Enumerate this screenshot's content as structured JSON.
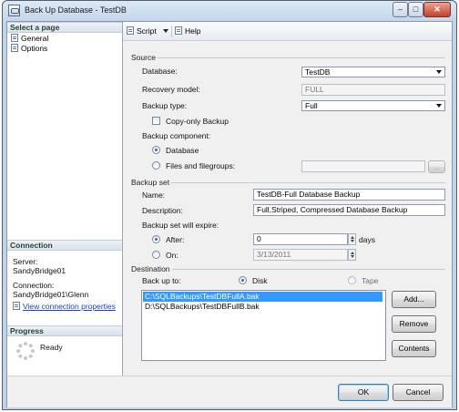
{
  "window": {
    "title": "Back Up Database - TestDB",
    "minimize": "–",
    "maximize": "□",
    "close": "✕"
  },
  "left_pane": {
    "select_page_header": "Select a page",
    "pages": [
      {
        "label": "General",
        "icon": "page-icon"
      },
      {
        "label": "Options",
        "icon": "page-icon"
      }
    ],
    "connection_header": "Connection",
    "server_label": "Server:",
    "server_value": "SandyBridge01",
    "connection_label": "Connection:",
    "connection_value": "SandyBridge01\\Glenn",
    "view_connection_link": "View connection properties",
    "progress_header": "Progress",
    "progress_status": "Ready"
  },
  "toolbar": {
    "script_label": "Script",
    "help_label": "Help"
  },
  "source": {
    "section_label": "Source",
    "database_label": "Database:",
    "database_value": "TestDB",
    "recovery_model_label": "Recovery model:",
    "recovery_model_value": "FULL",
    "backup_type_label": "Backup type:",
    "backup_type_value": "Full",
    "copy_only_label": "Copy-only Backup",
    "backup_component_label": "Backup component:",
    "database_radio_label": "Database",
    "files_radio_label": "Files and filegroups:",
    "browse_label": "..."
  },
  "backup_set": {
    "section_label": "Backup set",
    "name_label": "Name:",
    "name_value": "TestDB-Full Database Backup",
    "description_label": "Description:",
    "description_value": "Full,Striped, Compressed Database Backup",
    "expire_label": "Backup set will expire:",
    "after_label": "After:",
    "after_value": "0",
    "days_label": "days",
    "on_label": "On:",
    "on_value": "3/13/2011"
  },
  "destination": {
    "section_label": "Destination",
    "back_up_to_label": "Back up to:",
    "disk_label": "Disk",
    "tape_label": "Tape",
    "files": [
      "C:\\SQLBackups\\TestDBFullA.bak",
      "D:\\SQLBackups\\TestDBFullB.bak"
    ],
    "add_label": "Add...",
    "remove_label": "Remove",
    "contents_label": "Contents"
  },
  "footer": {
    "ok_label": "OK",
    "cancel_label": "Cancel"
  }
}
